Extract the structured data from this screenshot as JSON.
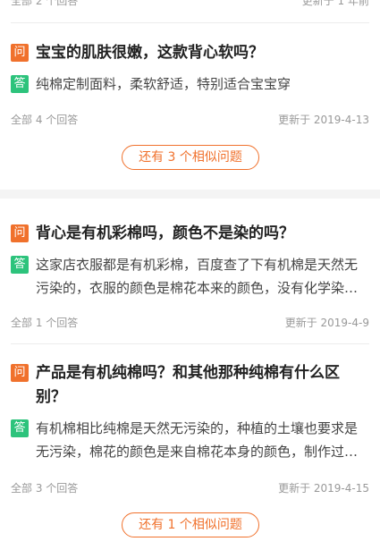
{
  "top_partial": {
    "answers": "全部 2 个回答",
    "updated": "更新于 1 年前"
  },
  "items": [
    {
      "q_badge": "问",
      "question": "宝宝的肌肤很嫩，这款背心软吗？",
      "a_badge": "答",
      "answer": "纯棉定制面料，柔软舒适，特别适合宝宝穿",
      "answers_count": "全部 4 个回答",
      "updated": "更新于 2019-4-13"
    },
    {
      "q_badge": "问",
      "question": "背心是有机彩棉吗，颜色不是染的吗？",
      "a_badge": "答",
      "answer": "这家店衣服都是有机彩棉，百度查了下有机棉是天然无污染的，衣服的颜色是棉花本来的颜色，没有化学染料的",
      "answers_count": "全部 1 个回答",
      "updated": "更新于 2019-4-9"
    },
    {
      "q_badge": "问",
      "question": "产品是有机纯棉吗？和其他那种纯棉有什么区别？",
      "a_badge": "答",
      "answer": "有机棉相比纯棉是天然无污染的，种植的土壤也要求是无污染，棉花的颜色是来自棉花本身的颜色，制作过程中也不添加化学物质",
      "answers_count": "全部 3 个回答",
      "updated": "更新于 2019-4-15"
    }
  ],
  "similar_buttons": [
    "还有 3 个相似问题",
    "还有 1 个相似问题"
  ],
  "colors": {
    "question_badge": "#f0712c",
    "answer_badge": "#2dc37c",
    "accent": "#f0712c"
  }
}
